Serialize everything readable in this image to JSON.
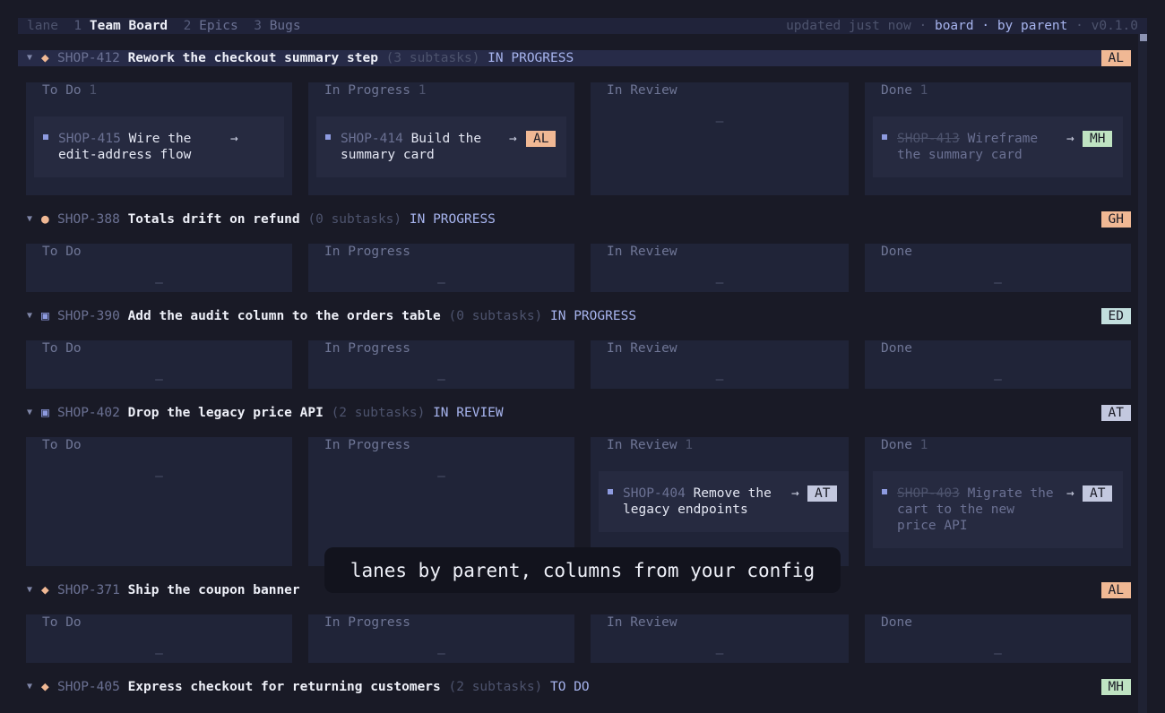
{
  "topbar": {
    "app": "lane",
    "tabs": [
      {
        "num": "1",
        "label": "Team Board"
      },
      {
        "num": "2",
        "label": "Epics"
      },
      {
        "num": "3",
        "label": "Bugs"
      }
    ],
    "updated": "updated just now",
    "sep": "·",
    "view": "board",
    "grouping": "by parent",
    "version": "v0.1.0"
  },
  "lanes": [
    {
      "key": "SHOP-412",
      "title": "Rework the checkout summary step",
      "subtasks": "(3 subtasks)",
      "status": "IN PROGRESS",
      "assignee": "AL",
      "glyph": "◆"
    },
    {
      "key": "SHOP-388",
      "title": "Totals drift on refund",
      "subtasks": "(0 subtasks)",
      "status": "IN PROGRESS",
      "assignee": "GH",
      "glyph": "●"
    },
    {
      "key": "SHOP-390",
      "title": "Add the audit column to the orders table",
      "subtasks": "(0 subtasks)",
      "status": "IN PROGRESS",
      "assignee": "ED",
      "glyph": "▣"
    },
    {
      "key": "SHOP-402",
      "title": "Drop the legacy price API",
      "subtasks": "(2 subtasks)",
      "status": "IN REVIEW",
      "assignee": "AT",
      "glyph": "▣"
    },
    {
      "key": "SHOP-371",
      "title": "Ship the coupon banner",
      "subtasks": "",
      "status": "",
      "assignee": "AL",
      "glyph": "◆"
    },
    {
      "key": "SHOP-405",
      "title": "Express checkout for returning customers",
      "subtasks": "(2 subtasks)",
      "status": "TO DO",
      "assignee": "MH",
      "glyph": "◆"
    }
  ],
  "columns": {
    "todo": "To Do",
    "progress": "In Progress",
    "review": "In Review",
    "done": "Done"
  },
  "counts": {
    "one": "1"
  },
  "empty": "–",
  "arrow": "→",
  "cards": {
    "c415": {
      "key": "SHOP-415",
      "line1": "Wire the",
      "line2": "edit-address flow",
      "assignee": ""
    },
    "c414": {
      "key": "SHOP-414",
      "line1": "Build the",
      "line2": "summary card",
      "assignee": "AL"
    },
    "c413": {
      "key": "SHOP-413",
      "line1": "Wireframe",
      "line2": "the summary card",
      "assignee": "MH"
    },
    "c404": {
      "key": "SHOP-404",
      "line1": "Remove the",
      "line2": "legacy endpoints",
      "assignee": "AT"
    },
    "c403": {
      "key": "SHOP-403",
      "line1": "Migrate the",
      "line2": "cart to the new",
      "line3": "price API",
      "assignee": "AT"
    }
  },
  "toast": "lanes by parent, columns from your config",
  "colors": {
    "accent": "#a7b4ee",
    "badge_orange": "#f0b894",
    "badge_green": "#bfe3c2",
    "badge_teal": "#c3dfde",
    "badge_gray": "#c3c8df"
  }
}
